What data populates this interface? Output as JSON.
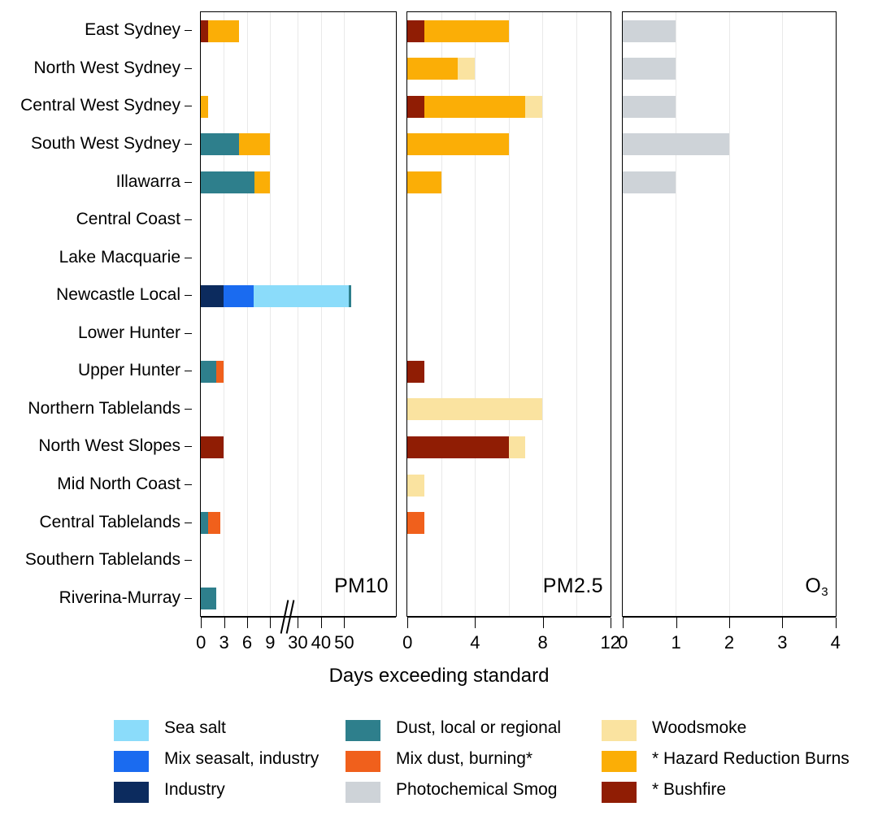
{
  "chart_data": {
    "type": "bar",
    "orientation": "horizontal",
    "stacked": true,
    "title": "",
    "xlabel": "Days exceeding standard",
    "ylabel": "",
    "grid": true,
    "legend_position": "bottom",
    "categories": [
      "East Sydney",
      "North West Sydney",
      "Central West Sydney",
      "South West Sydney",
      "Illawarra",
      "Central Coast",
      "Lake Macquarie",
      "Newcastle Local",
      "Lower Hunter",
      "Upper Hunter",
      "Northern Tablelands",
      "North West Slopes",
      "Mid North Coast",
      "Central Tablelands",
      "Southern Tablelands",
      "Riverina-Murray"
    ],
    "series": [
      {
        "name": "Sea salt",
        "color": "#8BDCFA"
      },
      {
        "name": "Mix seasalt, industry",
        "color": "#1A6BF0"
      },
      {
        "name": "Industry",
        "color": "#0C2B5E"
      },
      {
        "name": "Dust, local or regional",
        "color": "#2E7F8C"
      },
      {
        "name": "Mix dust, burning*",
        "color": "#F0601C"
      },
      {
        "name": "Photochemical Smog",
        "color": "#CED3D8"
      },
      {
        "name": "Woodsmoke",
        "color": "#FAE3A0"
      },
      {
        "name": "* Hazard Reduction Burns",
        "color": "#FBAE06"
      },
      {
        "name": "* Bushfire",
        "color": "#901D04"
      }
    ],
    "panels": [
      {
        "id": "pm10",
        "label": "PM10",
        "axis_break": true,
        "xlim": [
          0,
          55
        ],
        "ticks": [
          {
            "value": 0,
            "label": "0"
          },
          {
            "value": 3,
            "label": "3"
          },
          {
            "value": 6,
            "label": "6"
          },
          {
            "value": 9,
            "label": "9"
          },
          {
            "value": 30,
            "label": "30"
          },
          {
            "value": 40,
            "label": "40"
          },
          {
            "value": 50,
            "label": "50"
          }
        ],
        "gridlines": [
          3,
          6,
          9,
          30,
          40,
          50
        ],
        "rows": [
          {
            "category": "East Sydney",
            "segments": [
              {
                "series": "* Bushfire",
                "value": 1
              },
              {
                "series": "* Hazard Reduction Burns",
                "value": 4
              }
            ]
          },
          {
            "category": "North West Sydney",
            "segments": []
          },
          {
            "category": "Central West Sydney",
            "segments": [
              {
                "series": "* Hazard Reduction Burns",
                "value": 1
              }
            ]
          },
          {
            "category": "South West Sydney",
            "segments": [
              {
                "series": "Dust, local or regional",
                "value": 5
              },
              {
                "series": "* Hazard Reduction Burns",
                "value": 4
              }
            ]
          },
          {
            "category": "Illawarra",
            "segments": [
              {
                "series": "Dust, local or regional",
                "value": 7
              },
              {
                "series": "* Hazard Reduction Burns",
                "value": 2
              }
            ]
          },
          {
            "category": "Central Coast",
            "segments": []
          },
          {
            "category": "Lake Macquarie",
            "segments": []
          },
          {
            "category": "Newcastle Local",
            "segments": [
              {
                "series": "Industry",
                "value": 3
              },
              {
                "series": "Mix seasalt, industry",
                "value": 8
              },
              {
                "series": "Sea salt",
                "value": 41
              },
              {
                "series": "Dust, local or regional",
                "value": 1
              }
            ]
          },
          {
            "category": "Lower Hunter",
            "segments": []
          },
          {
            "category": "Upper Hunter",
            "segments": [
              {
                "series": "Dust, local or regional",
                "value": 2
              },
              {
                "series": "Mix dust, burning*",
                "value": 1
              }
            ]
          },
          {
            "category": "Northern Tablelands",
            "segments": []
          },
          {
            "category": "North West Slopes",
            "segments": [
              {
                "series": "* Bushfire",
                "value": 3
              }
            ]
          },
          {
            "category": "Mid North Coast",
            "segments": []
          },
          {
            "category": "Central Tablelands",
            "segments": [
              {
                "series": "Dust, local or regional",
                "value": 1
              },
              {
                "series": "Mix dust, burning*",
                "value": 1.5
              }
            ]
          },
          {
            "category": "Southern Tablelands",
            "segments": []
          },
          {
            "category": "Riverina-Murray",
            "segments": [
              {
                "series": "Dust, local or regional",
                "value": 2
              }
            ]
          }
        ]
      },
      {
        "id": "pm25",
        "label": "PM2.5",
        "axis_break": false,
        "xlim": [
          0,
          12
        ],
        "ticks": [
          {
            "value": 0,
            "label": "0"
          },
          {
            "value": 4,
            "label": "4"
          },
          {
            "value": 8,
            "label": "8"
          },
          {
            "value": 12,
            "label": "12"
          }
        ],
        "gridlines": [
          2,
          4,
          6,
          8,
          10
        ],
        "rows": [
          {
            "category": "East Sydney",
            "segments": [
              {
                "series": "* Bushfire",
                "value": 1
              },
              {
                "series": "* Hazard Reduction Burns",
                "value": 5
              }
            ]
          },
          {
            "category": "North West Sydney",
            "segments": [
              {
                "series": "* Hazard Reduction Burns",
                "value": 3
              },
              {
                "series": "Woodsmoke",
                "value": 1
              }
            ]
          },
          {
            "category": "Central West Sydney",
            "segments": [
              {
                "series": "* Bushfire",
                "value": 1
              },
              {
                "series": "* Hazard Reduction Burns",
                "value": 6
              },
              {
                "series": "Woodsmoke",
                "value": 1
              }
            ]
          },
          {
            "category": "South West Sydney",
            "segments": [
              {
                "series": "* Hazard Reduction Burns",
                "value": 6
              }
            ]
          },
          {
            "category": "Illawarra",
            "segments": [
              {
                "series": "* Hazard Reduction Burns",
                "value": 2
              }
            ]
          },
          {
            "category": "Central Coast",
            "segments": []
          },
          {
            "category": "Lake Macquarie",
            "segments": []
          },
          {
            "category": "Newcastle Local",
            "segments": []
          },
          {
            "category": "Lower Hunter",
            "segments": []
          },
          {
            "category": "Upper Hunter",
            "segments": [
              {
                "series": "* Bushfire",
                "value": 1
              }
            ]
          },
          {
            "category": "Northern Tablelands",
            "segments": [
              {
                "series": "Woodsmoke",
                "value": 8
              }
            ]
          },
          {
            "category": "North West Slopes",
            "segments": [
              {
                "series": "* Bushfire",
                "value": 6
              },
              {
                "series": "Woodsmoke",
                "value": 1
              }
            ]
          },
          {
            "category": "Mid North Coast",
            "segments": [
              {
                "series": "Woodsmoke",
                "value": 1
              }
            ]
          },
          {
            "category": "Central Tablelands",
            "segments": [
              {
                "series": "Mix dust, burning*",
                "value": 1
              }
            ]
          },
          {
            "category": "Southern Tablelands",
            "segments": []
          },
          {
            "category": "Riverina-Murray",
            "segments": []
          }
        ]
      },
      {
        "id": "o3",
        "label": "O3",
        "label_base": "O",
        "label_sub": "3",
        "axis_break": false,
        "xlim": [
          0,
          4
        ],
        "ticks": [
          {
            "value": 0,
            "label": "0"
          },
          {
            "value": 1,
            "label": "1"
          },
          {
            "value": 2,
            "label": "2"
          },
          {
            "value": 3,
            "label": "3"
          },
          {
            "value": 4,
            "label": "4"
          }
        ],
        "gridlines": [
          1,
          2,
          3
        ],
        "rows": [
          {
            "category": "East Sydney",
            "segments": [
              {
                "series": "Photochemical Smog",
                "value": 1
              }
            ]
          },
          {
            "category": "North West Sydney",
            "segments": [
              {
                "series": "Photochemical Smog",
                "value": 1
              }
            ]
          },
          {
            "category": "Central West Sydney",
            "segments": [
              {
                "series": "Photochemical Smog",
                "value": 1
              }
            ]
          },
          {
            "category": "South West Sydney",
            "segments": [
              {
                "series": "Photochemical Smog",
                "value": 2
              }
            ]
          },
          {
            "category": "Illawarra",
            "segments": [
              {
                "series": "Photochemical Smog",
                "value": 1
              }
            ]
          },
          {
            "category": "Central Coast",
            "segments": []
          },
          {
            "category": "Lake Macquarie",
            "segments": []
          },
          {
            "category": "Newcastle Local",
            "segments": []
          },
          {
            "category": "Lower Hunter",
            "segments": []
          },
          {
            "category": "Upper Hunter",
            "segments": []
          },
          {
            "category": "Northern Tablelands",
            "segments": []
          },
          {
            "category": "North West Slopes",
            "segments": []
          },
          {
            "category": "Mid North Coast",
            "segments": []
          },
          {
            "category": "Central Tablelands",
            "segments": []
          },
          {
            "category": "Southern Tablelands",
            "segments": []
          },
          {
            "category": "Riverina-Murray",
            "segments": []
          }
        ]
      }
    ],
    "legend": {
      "columns": [
        [
          {
            "label": "Sea salt",
            "color": "#8BDCFA"
          },
          {
            "label": "Mix seasalt, industry",
            "color": "#1A6BF0"
          },
          {
            "label": "Industry",
            "color": "#0C2B5E"
          }
        ],
        [
          {
            "label": "Dust, local or regional",
            "color": "#2E7F8C"
          },
          {
            "label": "Mix dust, burning*",
            "color": "#F0601C"
          },
          {
            "label": "Photochemical Smog",
            "color": "#CED3D8"
          }
        ],
        [
          {
            "label": "Woodsmoke",
            "color": "#FAE3A0"
          },
          {
            "label": "* Hazard Reduction Burns",
            "color": "#FBAE06"
          },
          {
            "label": "* Bushfire",
            "color": "#901D04"
          }
        ]
      ]
    }
  }
}
